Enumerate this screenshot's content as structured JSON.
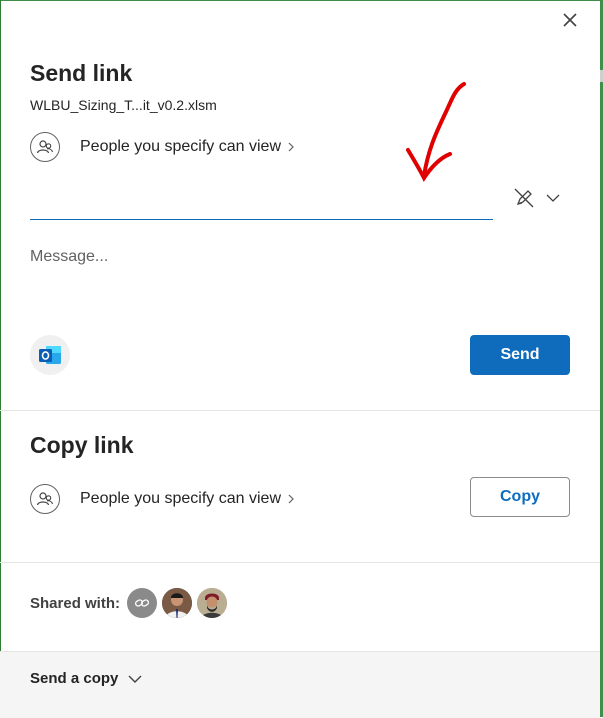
{
  "dialog": {
    "title": "Send link",
    "filename": "WLBU_Sizing_T...it_v0.2.xlsm",
    "close_icon": "close-icon"
  },
  "send_section": {
    "permission_text": "People you specify can view",
    "to_input_value": "",
    "message_placeholder": "Message...",
    "send_label": "Send",
    "outlook_icon": "outlook-icon",
    "edit_icon": "pencil-slash-icon"
  },
  "copy_section": {
    "title": "Copy link",
    "permission_text": "People you specify can view",
    "copy_label": "Copy"
  },
  "shared_with": {
    "label": "Shared with:",
    "avatars": [
      "link-avatar",
      "person-avatar-1",
      "person-avatar-2"
    ]
  },
  "footer": {
    "send_copy_label": "Send a copy"
  },
  "colors": {
    "accent": "#0f6cbd",
    "annotation": "#e00000",
    "excel_frame": "#3f8f4a"
  }
}
